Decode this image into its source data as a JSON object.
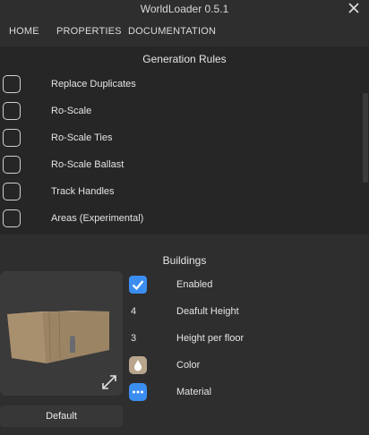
{
  "window": {
    "title": "WorldLoader 0.5.1"
  },
  "menu": {
    "items": [
      "HOME",
      "PROPERTIES",
      "DOCUMENTATION"
    ]
  },
  "generation_rules": {
    "title": "Generation Rules",
    "items": [
      {
        "label": "Replace Duplicates",
        "checked": false
      },
      {
        "label": "Ro-Scale",
        "checked": false
      },
      {
        "label": "Ro-Scale Ties",
        "checked": false
      },
      {
        "label": "Ro-Scale Ballast",
        "checked": false
      },
      {
        "label": "Track Handles",
        "checked": false
      },
      {
        "label": "Areas (Experimental)",
        "checked": false
      }
    ]
  },
  "buildings": {
    "title": "Buildings",
    "enabled": {
      "label": "Enabled",
      "checked": true
    },
    "default_height": {
      "value": "4",
      "label": "Deafult Height"
    },
    "height_per_floor": {
      "value": "3",
      "label": "Height per floor"
    },
    "color": {
      "label": "Color",
      "swatch": "#b8a58c"
    },
    "material": {
      "label": "Material"
    },
    "default_button": "Default"
  },
  "colors": {
    "accent": "#3b8ef0",
    "panel": "#262626",
    "background": "#2e2e2e"
  }
}
